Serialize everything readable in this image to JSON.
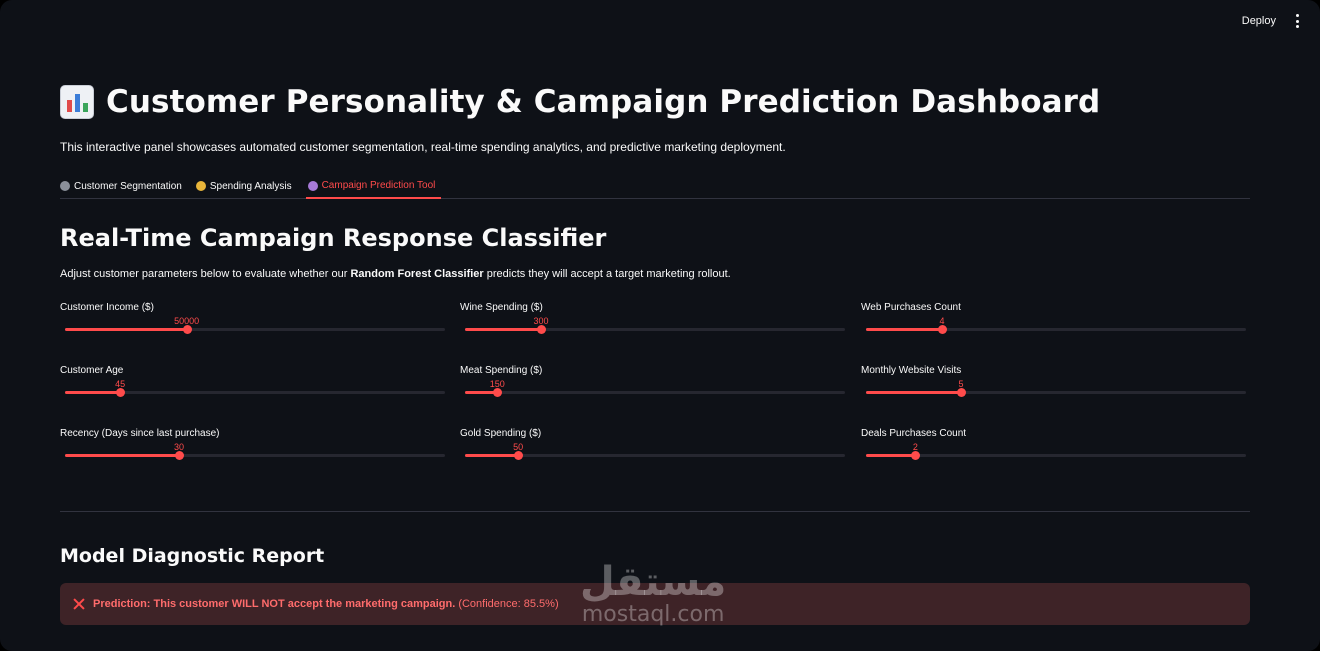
{
  "header": {
    "deploy_label": "Deploy",
    "menu_icon": "kebab-menu-icon"
  },
  "page": {
    "title_icon": "bar-chart-icon",
    "title": "Customer Personality & Campaign Prediction Dashboard",
    "subtitle": "This interactive panel showcases automated customer segmentation, real-time spending analytics, and predictive marketing deployment."
  },
  "tabs": [
    {
      "label": "Customer Segmentation",
      "icon": "people-icon",
      "active": false
    },
    {
      "label": "Spending Analysis",
      "icon": "money-bag-icon",
      "active": false
    },
    {
      "label": "Campaign Prediction Tool",
      "icon": "crystal-ball-icon",
      "active": true
    }
  ],
  "classifier": {
    "heading": "Real-Time Campaign Response Classifier",
    "desc_pre": "Adjust customer parameters below to evaluate whether our ",
    "desc_bold": "Random Forest Classifier",
    "desc_post": " predicts they will accept a target marketing rollout."
  },
  "sliders": [
    {
      "label": "Customer Income ($)",
      "value": "50000",
      "fraction": 0.32
    },
    {
      "label": "Customer Age",
      "value": "45",
      "fraction": 0.145
    },
    {
      "label": "Recency (Days since last purchase)",
      "value": "30",
      "fraction": 0.3
    },
    {
      "label": "Wine Spending ($)",
      "value": "300",
      "fraction": 0.2
    },
    {
      "label": "Meat Spending ($)",
      "value": "150",
      "fraction": 0.085
    },
    {
      "label": "Gold Spending ($)",
      "value": "50",
      "fraction": 0.14
    },
    {
      "label": "Web Purchases Count",
      "value": "4",
      "fraction": 0.2
    },
    {
      "label": "Monthly Website Visits",
      "value": "5",
      "fraction": 0.25
    },
    {
      "label": "Deals Purchases Count",
      "value": "2",
      "fraction": 0.13
    }
  ],
  "report": {
    "heading": "Model Diagnostic Report",
    "alert_icon": "close-x-icon",
    "prediction": "Prediction: This customer WILL NOT accept the marketing campaign.",
    "confidence": "(Confidence: 85.5%)"
  },
  "watermark": {
    "arabic": "مستقل",
    "latin": "mostaql.com"
  },
  "colors": {
    "accent": "#ff4b4b",
    "background": "#0e1117",
    "alert_bg": "#3e2327"
  }
}
